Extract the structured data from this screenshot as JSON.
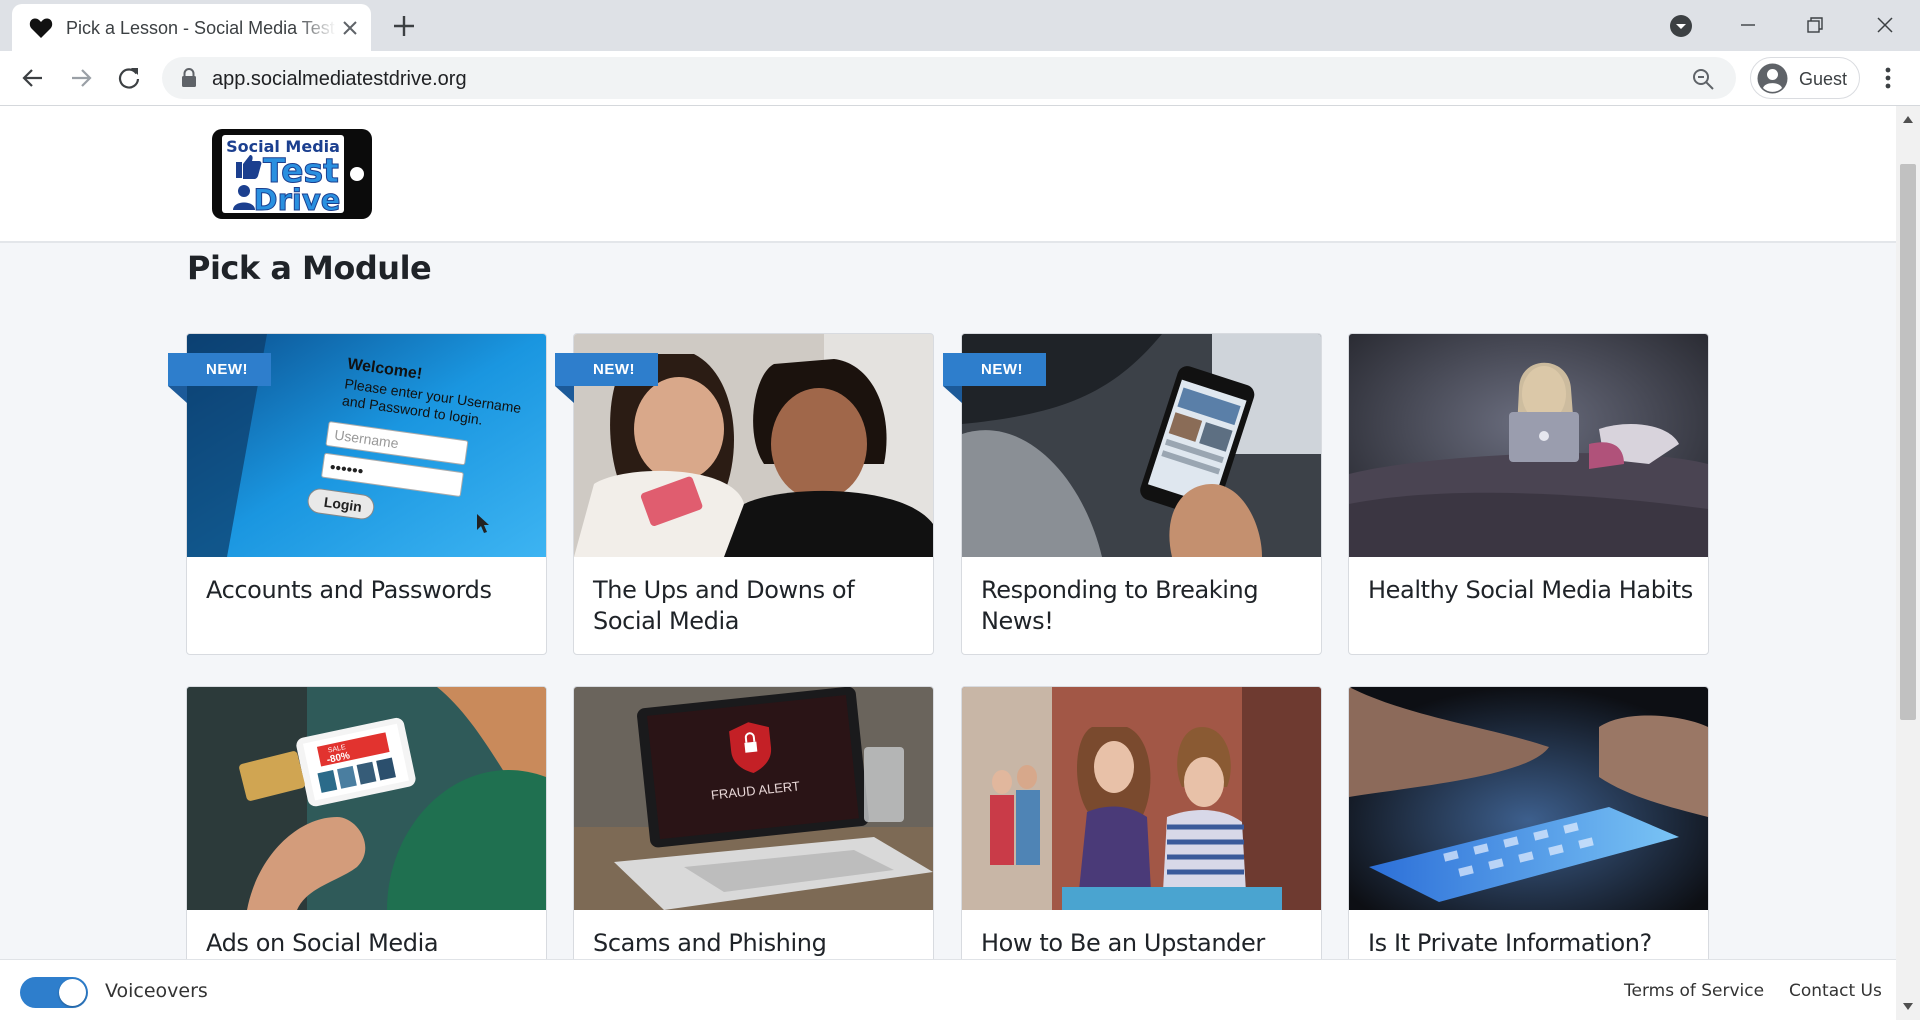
{
  "browser": {
    "tab_title": "Pick a Lesson - Social Media Test Drive",
    "tab_favicon": "heart-icon",
    "url": "app.socialmediatestdrive.org",
    "profile_label": "Guest"
  },
  "header": {
    "logo_line1": "Social Media",
    "logo_line2": "Test",
    "logo_line3": "Drive"
  },
  "main": {
    "title": "Pick a Module",
    "badge_label": "NEW!",
    "modules": [
      {
        "title": "Accounts and Passwords",
        "is_new": true
      },
      {
        "title": "The Ups and Downs of Social Media",
        "is_new": true
      },
      {
        "title": "Responding to Breaking News!",
        "is_new": true
      },
      {
        "title": "Healthy Social Media Habits",
        "is_new": false
      },
      {
        "title": "Ads on Social Media",
        "is_new": false
      },
      {
        "title": "Scams and Phishing",
        "is_new": false
      },
      {
        "title": "How to Be an Upstander",
        "is_new": false
      },
      {
        "title": "Is It Private Information?",
        "is_new": false
      }
    ],
    "image_text": {
      "welcome": "Welcome!",
      "instructions_line1": "Please enter your Username",
      "instructions_line2": "and Password to login.",
      "username_placeholder": "Username",
      "password_mask": "••••••",
      "login_button": "Login",
      "fraud_alert": "FRAUD ALERT",
      "sale_label": "SALE",
      "discount": "-80%"
    }
  },
  "footer": {
    "voiceovers_label": "Voiceovers",
    "voiceovers_on": true,
    "terms_label": "Terms of Service",
    "contact_label": "Contact Us"
  },
  "colors": {
    "accent": "#2e7ecc",
    "badge_fold": "#1c5a99",
    "page_bg": "#f4f6f9"
  }
}
